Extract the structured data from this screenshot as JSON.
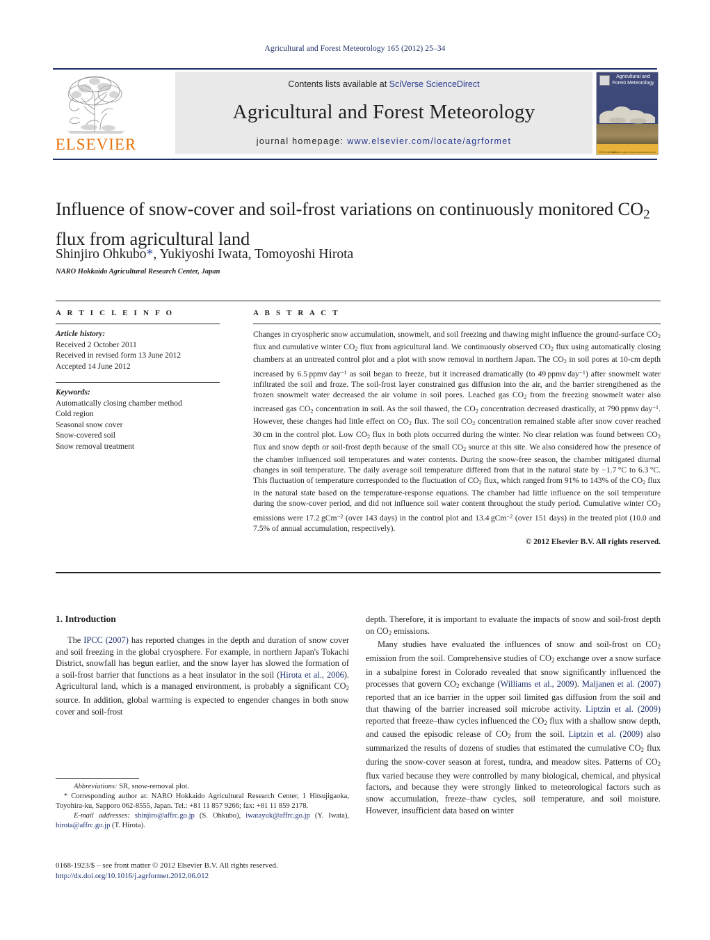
{
  "running_head": "Agricultural and Forest Meteorology 165 (2012) 25–34",
  "header": {
    "contents_prefix": "Contents lists available at ",
    "sciencedirect": "SciVerse ScienceDirect",
    "journal_title": "Agricultural and Forest Meteorology",
    "homepage_prefix": "journal homepage: ",
    "homepage_url": "www.elsevier.com/locate/agrformet",
    "publisher_logo_text": "ELSEVIER",
    "publisher_logo_icon": "elsevier-tree-icon",
    "cover_title": "Agricultural and Forest Meteorology",
    "cover_footer_left": "ISSN 0168-1923",
    "cover_footer_right": "Available online at www.sciencedirect.com"
  },
  "article": {
    "title": "Influence of snow-cover and soil-frost variations on continuously monitored CO₂ flux from agricultural land",
    "authors": "Shinjiro Ohkubo*, Yukiyoshi Iwata, Tomoyoshi Hirota",
    "affiliation": "NARO Hokkaido Agricultural Research Center, Japan"
  },
  "article_info": {
    "heading": "A R T I C L E   I N F O",
    "history_label": "Article history:",
    "history": [
      "Received 2 October 2011",
      "Received in revised form 13 June 2012",
      "Accepted 14 June 2012"
    ],
    "keywords_label": "Keywords:",
    "keywords": [
      "Automatically closing chamber method",
      "Cold region",
      "Seasonal snow cover",
      "Snow-covered soil",
      "Snow removal treatment"
    ]
  },
  "abstract": {
    "heading": "A B S T R A C T",
    "copyright": "© 2012 Elsevier B.V. All rights reserved."
  },
  "sections": {
    "intro_heading": "1.  Introduction"
  },
  "footnotes": {
    "abbrev_label": "Abbreviations:",
    "abbrev_text": " SR, snow-removal plot.",
    "email_label": "E-mail addresses:",
    "email1": "shinjiro@affrc.go.jp",
    "email1_who": " (S. Ohkubo), ",
    "email2": "iwatayuk@affrc.go.jp",
    "email2_who": " (Y. Iwata), ",
    "email3": "hirota@affrc.go.jp",
    "email3_who": " (T. Hirota).",
    "issn_line": "0168-1923/$ – see front matter © 2012 Elsevier B.V. All rights reserved.",
    "doi_line": "http://dx.doi.org/10.1016/j.agrformet.2012.06.012"
  },
  "colors": {
    "link": "#1c3070",
    "header_rule": "#1c2d66",
    "elsevier_orange": "#e8720c",
    "panel_grey": "#e9e9ea"
  }
}
